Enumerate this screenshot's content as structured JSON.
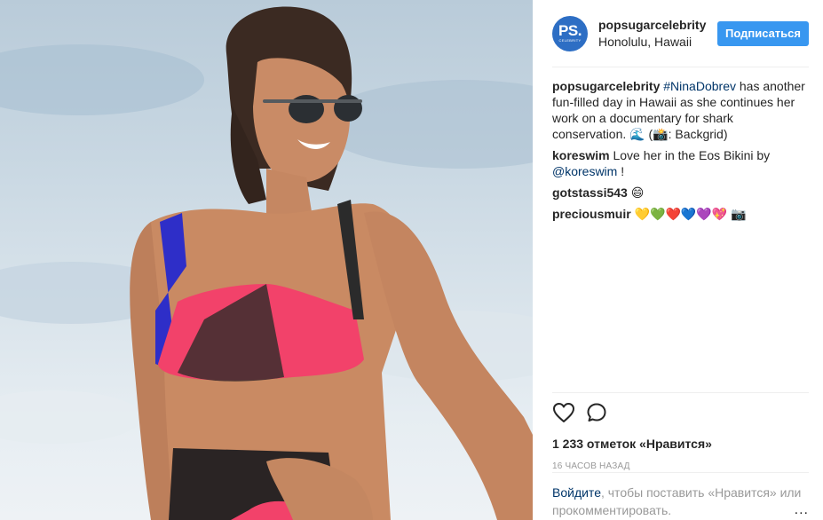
{
  "header": {
    "avatar_text": "PS.",
    "avatar_subtext": "CELEBRITY",
    "username": "popsugarcelebrity",
    "location": "Honolulu, Hawaii",
    "follow_label": "Подписаться"
  },
  "caption": {
    "username": "popsugarcelebrity",
    "hashtag": "#NinaDobrev",
    "text": " has another fun-filled day in Hawaii as she continues her work on a documentary for shark conservation. 🌊 (📸: Backgrid)"
  },
  "comments": [
    {
      "username": "koreswim",
      "text_before": "Love her in the Eos Bikini by ",
      "mention": "@koreswim",
      "text_after": " !"
    },
    {
      "username": "gotstassi543",
      "text": "😄"
    },
    {
      "username": "preciousmuir",
      "text": "💛💚❤️💙💜💖 📷"
    }
  ],
  "actions": {
    "like_icon": "heart-icon",
    "comment_icon": "comment-icon"
  },
  "likes": "1 233 отметок «Нравится»",
  "timestamp": "16 часов назад",
  "login": {
    "login_link": "Войдите",
    "text": ", чтобы поставить «Нравится» или прокомментировать.",
    "more": "..."
  },
  "colors": {
    "accent": "#3897f0",
    "link": "#003569",
    "avatar": "#2d6ec4"
  }
}
